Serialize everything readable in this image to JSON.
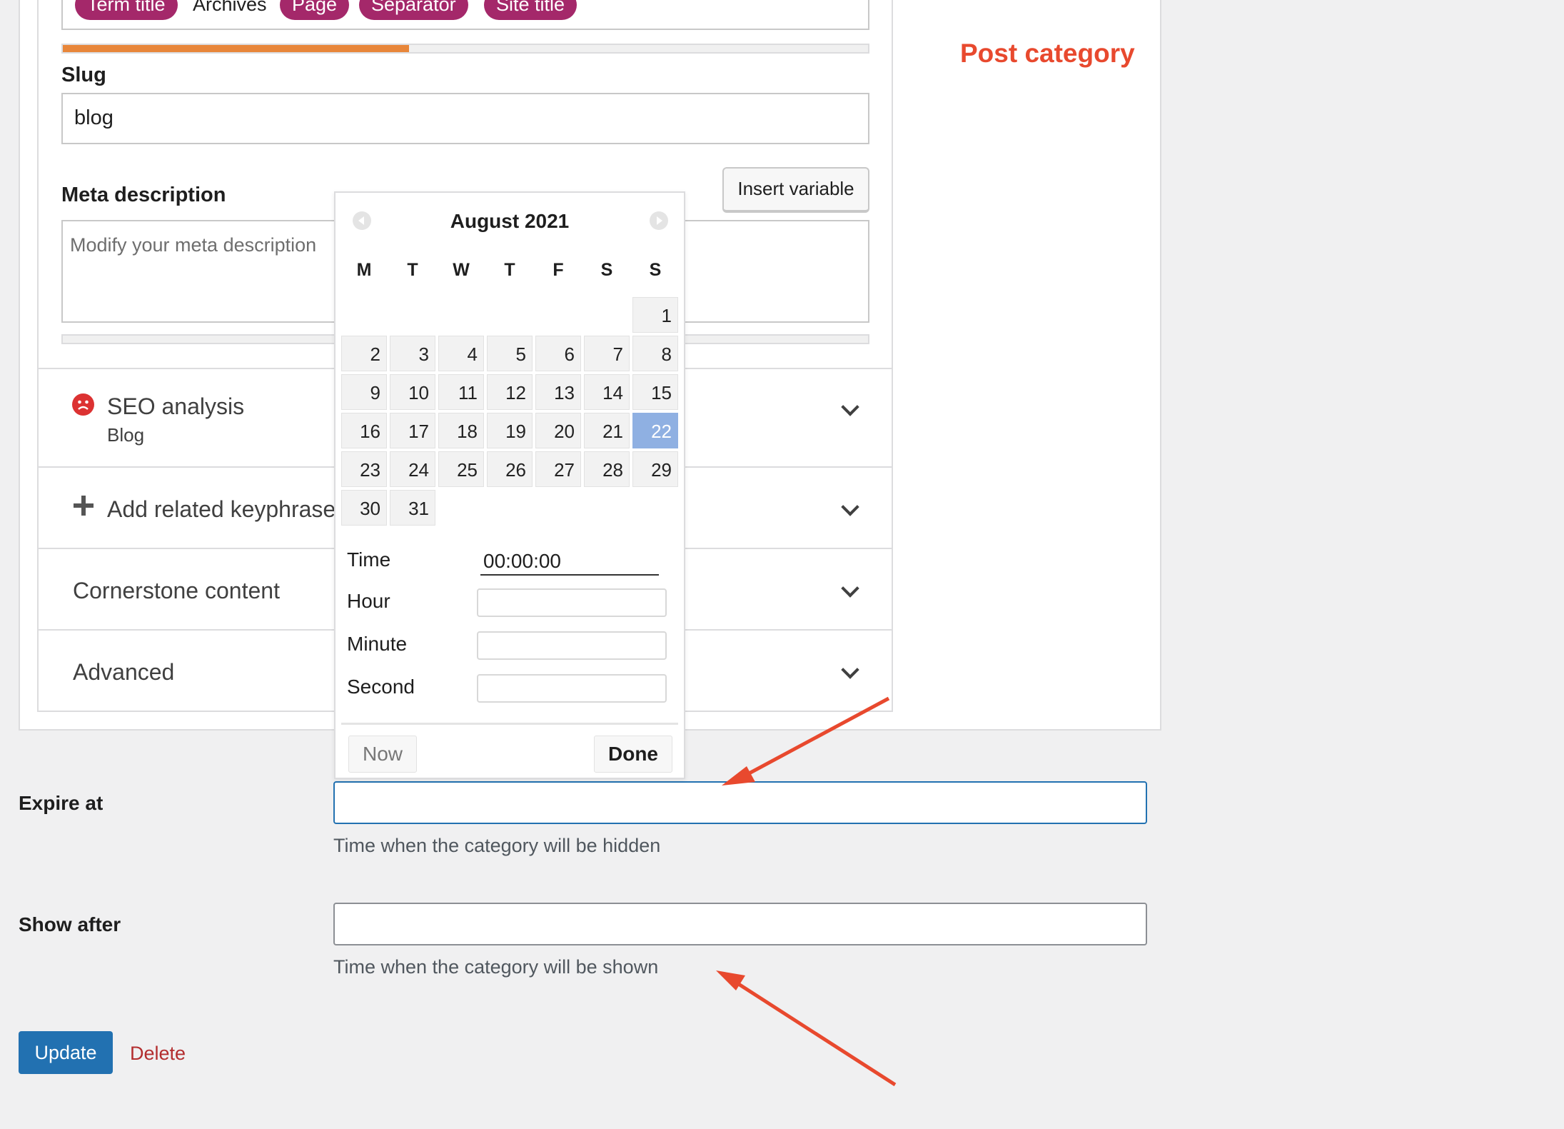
{
  "snippet": {
    "pills": [
      "Term title",
      "Page",
      "Separator",
      "Site title"
    ],
    "plain_word": "Archives",
    "seo_title_progress": 0.43
  },
  "slug": {
    "label": "Slug",
    "value": "blog"
  },
  "meta": {
    "label": "Meta description",
    "placeholder": "Modify your meta description",
    "insert_variable": "Insert variable"
  },
  "sections": {
    "seo_analysis": "SEO analysis",
    "seo_keyphrase": "Blog",
    "related": "Add related keyphrase",
    "cornerstone": "Cornerstone content",
    "advanced": "Advanced"
  },
  "annotation": {
    "post_category": "Post category"
  },
  "datepicker": {
    "month": "August 2021",
    "weekdays": [
      "M",
      "T",
      "W",
      "T",
      "F",
      "S",
      "S"
    ],
    "days": [
      [
        null,
        null,
        null,
        null,
        null,
        null,
        1
      ],
      [
        2,
        3,
        4,
        5,
        6,
        7,
        8
      ],
      [
        9,
        10,
        11,
        12,
        13,
        14,
        15
      ],
      [
        16,
        17,
        18,
        19,
        20,
        21,
        22
      ],
      [
        23,
        24,
        25,
        26,
        27,
        28,
        29
      ],
      [
        30,
        31,
        null,
        null,
        null,
        null,
        null
      ]
    ],
    "selected_day": 22,
    "time_label": "Time",
    "time_value": "00:00:00",
    "hour_label": "Hour",
    "minute_label": "Minute",
    "second_label": "Second",
    "now_label": "Now",
    "done_label": "Done"
  },
  "expire": {
    "label": "Expire at",
    "hint": "Time when the category will be hidden",
    "value": ""
  },
  "show_after": {
    "label": "Show after",
    "hint": "Time when the category will be shown",
    "value": ""
  },
  "actions": {
    "update": "Update",
    "delete": "Delete"
  },
  "colors": {
    "accent": "#2271b1",
    "pill": "#a4286a",
    "annotation": "#e8492e",
    "progress": "#e8863a",
    "selected_day": "#8fb0e2"
  }
}
